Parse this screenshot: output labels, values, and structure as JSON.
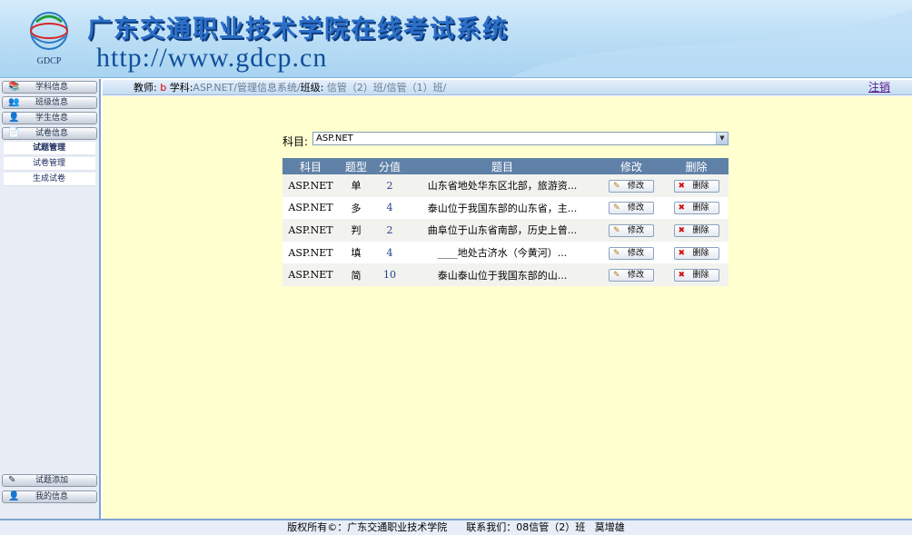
{
  "header": {
    "title": "广东交通职业技术学院在线考试系统",
    "url": "http://www.gdcp.cn",
    "logo_text": "GDCP"
  },
  "sidebar": {
    "items": [
      {
        "label": "学科信息",
        "icon": "books-icon"
      },
      {
        "label": "班级信息",
        "icon": "users-icon"
      },
      {
        "label": "学生信息",
        "icon": "student-icon"
      },
      {
        "label": "试卷信息",
        "icon": "paper-icon"
      }
    ],
    "subitems": [
      "试题管理",
      "试卷管理",
      "生成试卷"
    ],
    "bottom_items": [
      {
        "label": "试题添加",
        "icon": "add-icon"
      },
      {
        "label": "我的信息",
        "icon": "user-info-icon"
      }
    ]
  },
  "infobar": {
    "teacher_label": "教师:",
    "teacher": "b",
    "subject_label": "学科:",
    "subject": "ASP.NET/管理信息系统/",
    "class_label": "班级:",
    "classes": "信管（2）班/信管（1）班/",
    "logout": "注销"
  },
  "filter": {
    "label": "科目:",
    "selected": "ASP.NET"
  },
  "table": {
    "headers": [
      "科目",
      "题型",
      "分值",
      "题目",
      "修改",
      "删除"
    ],
    "edit_label": "修改",
    "delete_label": "删除",
    "rows": [
      {
        "subject": "ASP.NET",
        "type": "单",
        "score": "2",
        "title": "山东省地处华东区北部，旅游资..."
      },
      {
        "subject": "ASP.NET",
        "type": "多",
        "score": "4",
        "title": "泰山位于我国东部的山东省，主..."
      },
      {
        "subject": "ASP.NET",
        "type": "判",
        "score": "2",
        "title": "曲阜位于山东省南部，历史上曾..."
      },
      {
        "subject": "ASP.NET",
        "type": "填",
        "score": "4",
        "title": "____地处古济水（今黄河）..."
      },
      {
        "subject": "ASP.NET",
        "type": "简",
        "score": "10",
        "title": "泰山泰山位于我国东部的山..."
      }
    ]
  },
  "footer": {
    "copyright": "版权所有©：广东交通职业技术学院",
    "contact": "联系我们：08信管（2）班   莫增雄"
  },
  "colors": {
    "table_header": "#5f81a7",
    "main_bg": "#ffffd0",
    "title_blue": "#2c6fc9"
  }
}
